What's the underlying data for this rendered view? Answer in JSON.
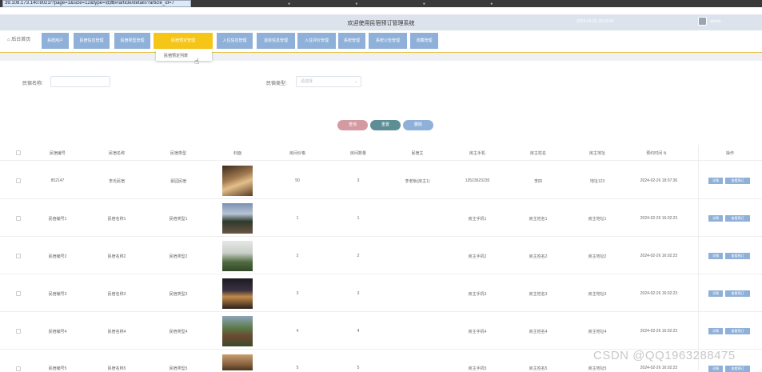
{
  "browser": {
    "url": "39.108.173.140:8021/?page=1&size=12&type=效图#/article/details?article_id=7"
  },
  "header": {
    "title": "欢迎使用民宿预订管理系统",
    "time": "2024-02-26 18:13:04",
    "username": "admin"
  },
  "nav": {
    "home_label": "后台首页",
    "items": [
      {
        "label": "系统用户"
      },
      {
        "label": "民宿信息管理"
      },
      {
        "label": "民宿类型管理"
      },
      {
        "label": "民宿预定管理"
      },
      {
        "label": "入住信息管理"
      },
      {
        "label": "退房信息管理"
      },
      {
        "label": "入住评价管理"
      },
      {
        "label": "系统管理"
      },
      {
        "label": "系统公告管理"
      },
      {
        "label": "收藏管理"
      }
    ],
    "dropdown_item": "民宿预定列表"
  },
  "search": {
    "name_label": "民宿名称:",
    "type_label": "民宿类型:",
    "type_placeholder": "请选择"
  },
  "buttons": {
    "query": "查询",
    "reset": "重置",
    "delete": "删除"
  },
  "colors": {
    "query": "#d49aa2",
    "reset": "#5e8e95",
    "delete": "#8fb1d9",
    "active_nav": "#f5c518",
    "nav": "#8fb1d9"
  },
  "table": {
    "columns": [
      "民宿编号",
      "民宿名称",
      "民宿类型",
      "封面",
      "房间价格",
      "房间数量",
      "民宿主",
      "房主手机",
      "房主姓名",
      "房主地址",
      "预约时间 ⇅",
      "操作"
    ],
    "action_detail": "详情",
    "action_book": "查看预订",
    "rows": [
      {
        "id": "852147",
        "name": "李氏民宿",
        "type": "豪园民宿",
        "price": "50",
        "qty": "3",
        "owner": "李老板(房主1)",
        "phone": "13523623235",
        "owner_name": "李四",
        "address": "地址123",
        "time": "2024-02-26 18:07:36"
      },
      {
        "id": "民宿编号1",
        "name": "民宿名称1",
        "type": "民宿类型1",
        "price": "1",
        "qty": "1",
        "owner": "",
        "phone": "房主手机1",
        "owner_name": "房主姓名1",
        "address": "房主地址1",
        "time": "2024-02-26 16:02:23"
      },
      {
        "id": "民宿编号2",
        "name": "民宿名称2",
        "type": "民宿类型2",
        "price": "2",
        "qty": "2",
        "owner": "",
        "phone": "房主手机2",
        "owner_name": "房主姓名2",
        "address": "房主地址2",
        "time": "2024-02-26 16:02:23"
      },
      {
        "id": "民宿编号3",
        "name": "民宿名称3",
        "type": "民宿类型3",
        "price": "3",
        "qty": "3",
        "owner": "",
        "phone": "房主手机3",
        "owner_name": "房主姓名3",
        "address": "房主地址3",
        "time": "2024-02-26 16:02:23"
      },
      {
        "id": "民宿编号4",
        "name": "民宿名称4",
        "type": "民宿类型4",
        "price": "4",
        "qty": "4",
        "owner": "",
        "phone": "房主手机4",
        "owner_name": "房主姓名4",
        "address": "房主地址4",
        "time": "2024-02-26 16:02:23"
      },
      {
        "id": "民宿编号5",
        "name": "民宿名称5",
        "type": "民宿类型5",
        "price": "5",
        "qty": "5",
        "owner": "",
        "phone": "房主手机5",
        "owner_name": "房主姓名5",
        "address": "房主地址5",
        "time": "2024-02-26 16:02:23"
      }
    ]
  },
  "watermark": "CSDN @QQ1963288475"
}
